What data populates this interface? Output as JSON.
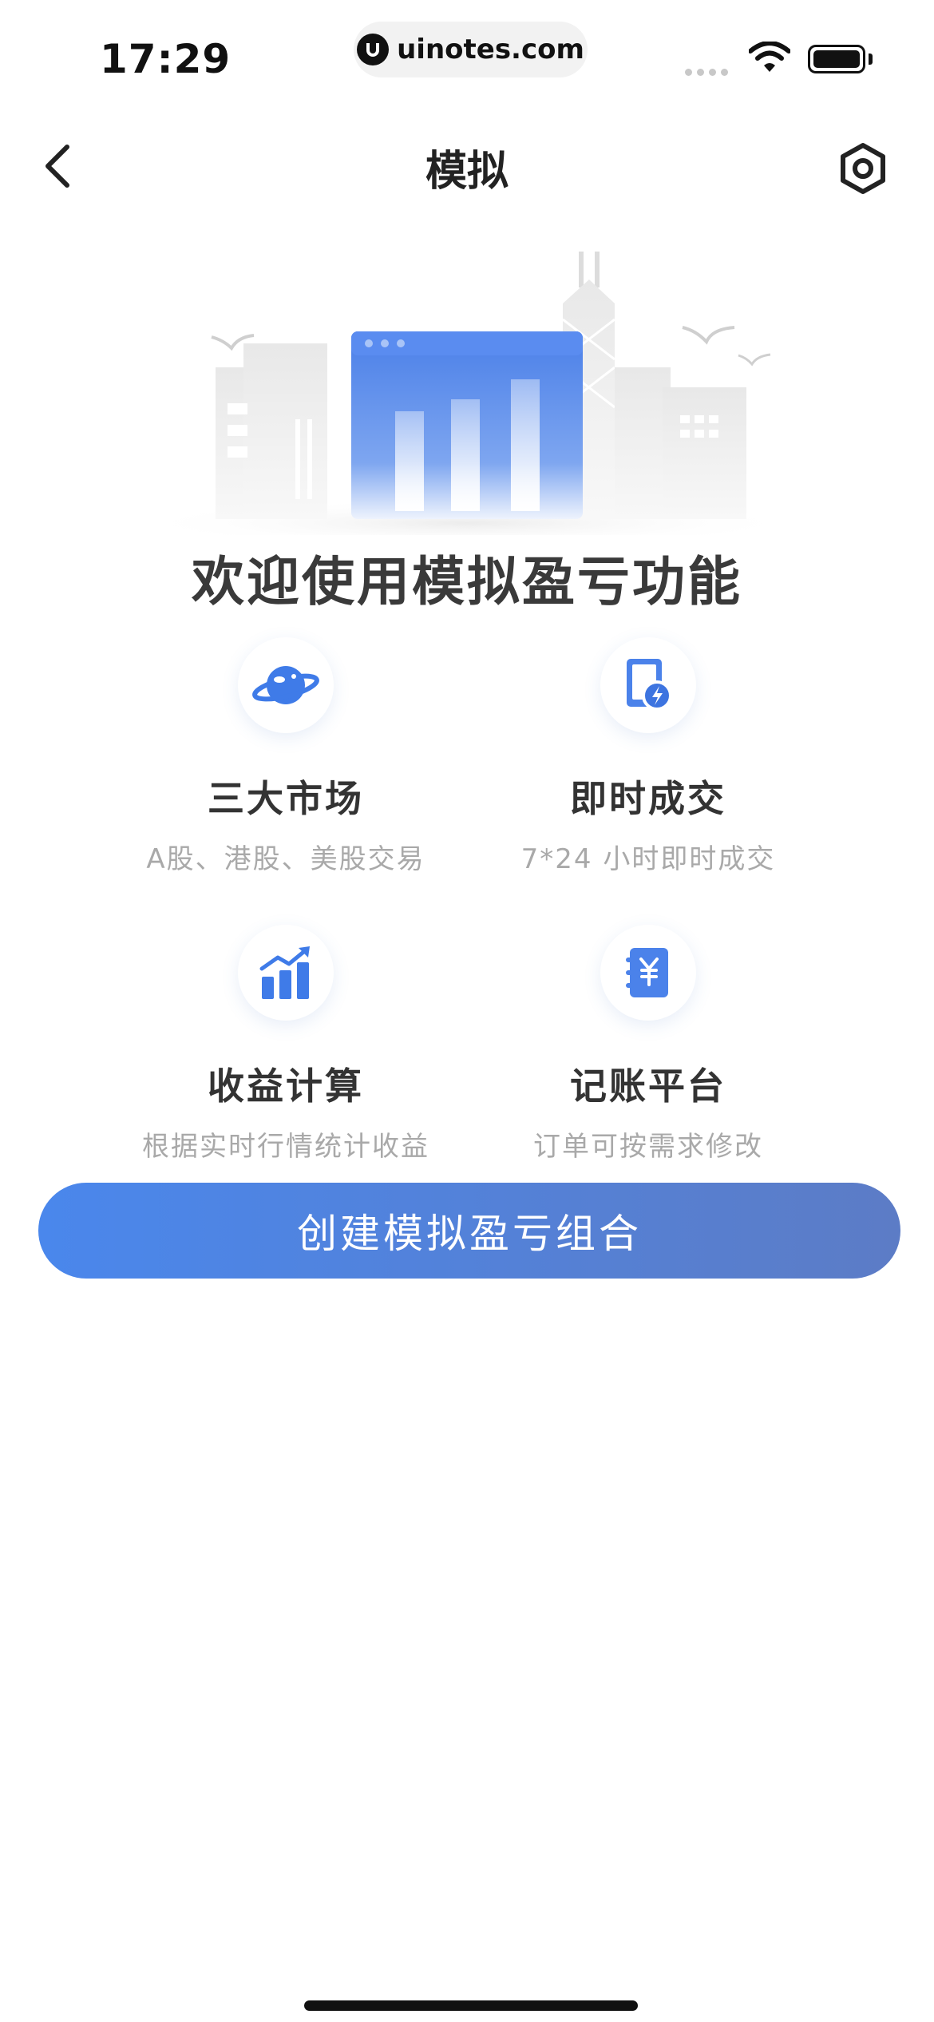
{
  "status_bar": {
    "time": "17:29",
    "url": "uinotes.com"
  },
  "nav": {
    "title": "模拟",
    "back_icon": "chevron-left-icon",
    "settings_icon": "hexagon-gear-icon"
  },
  "welcome_text": "欢迎使用模拟盈亏功能",
  "features": [
    {
      "icon": "planet-icon",
      "title": "三大市场",
      "subtitle": "A股、港股、美股交易"
    },
    {
      "icon": "instant-trade-icon",
      "title": "即时成交",
      "subtitle": "7*24 小时即时成交"
    },
    {
      "icon": "growth-chart-icon",
      "title": "收益计算",
      "subtitle": "根据实时行情统计收益"
    },
    {
      "icon": "ledger-yen-icon",
      "title": "记账平台",
      "subtitle": "订单可按需求修改"
    }
  ],
  "cta_button": "创建模拟盈亏组合",
  "colors": {
    "accent": "#4a87ec",
    "accent_end": "#5c7cc6",
    "subtitle": "#a9a9a9"
  }
}
